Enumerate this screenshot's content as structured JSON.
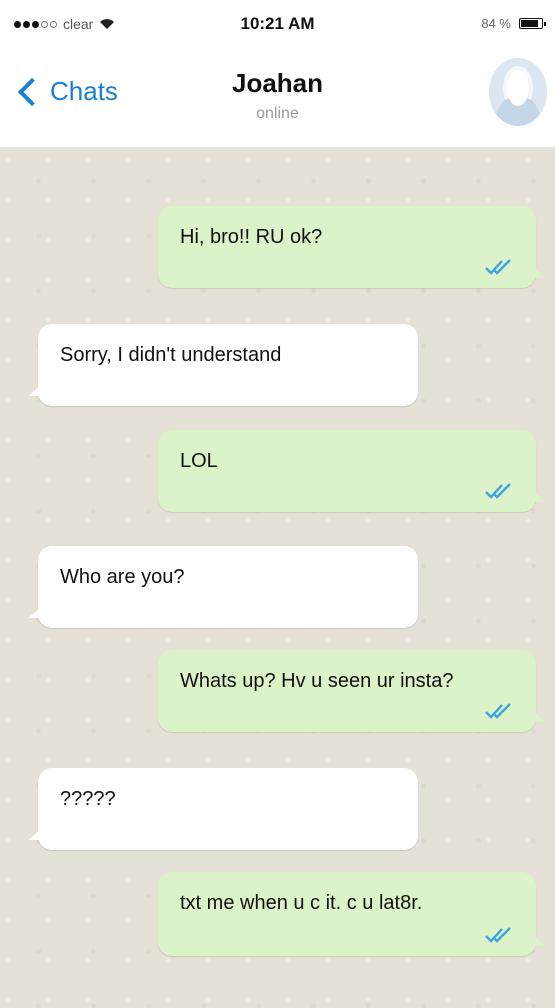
{
  "status_bar": {
    "carrier": "clear",
    "time": "10:21 AM",
    "battery_text": "84 %",
    "battery_level": 0.84,
    "signal_bars_filled": 3,
    "signal_bars_total": 5
  },
  "nav": {
    "back_label": "Chats",
    "contact_name": "Joahan",
    "contact_status": "online",
    "accent_color": "#1a7fd6"
  },
  "messages": [
    {
      "direction": "outgoing",
      "text": "Hi, bro!! RU ok?",
      "read": true
    },
    {
      "direction": "incoming",
      "text": "Sorry, I didn't understand"
    },
    {
      "direction": "outgoing",
      "text": "LOL",
      "read": true
    },
    {
      "direction": "incoming",
      "text": "Who are you?"
    },
    {
      "direction": "outgoing",
      "text": "Whats up? Hv u seen ur insta?",
      "read": true
    },
    {
      "direction": "incoming",
      "text": "?????"
    },
    {
      "direction": "outgoing",
      "text": "txt me when u c it. c u lat8r.",
      "read": true
    }
  ],
  "colors": {
    "outgoing_bubble": "#dcf2c8",
    "incoming_bubble": "#ffffff",
    "chat_background": "#e6e1d6",
    "read_ticks": "#3aa6e0"
  }
}
